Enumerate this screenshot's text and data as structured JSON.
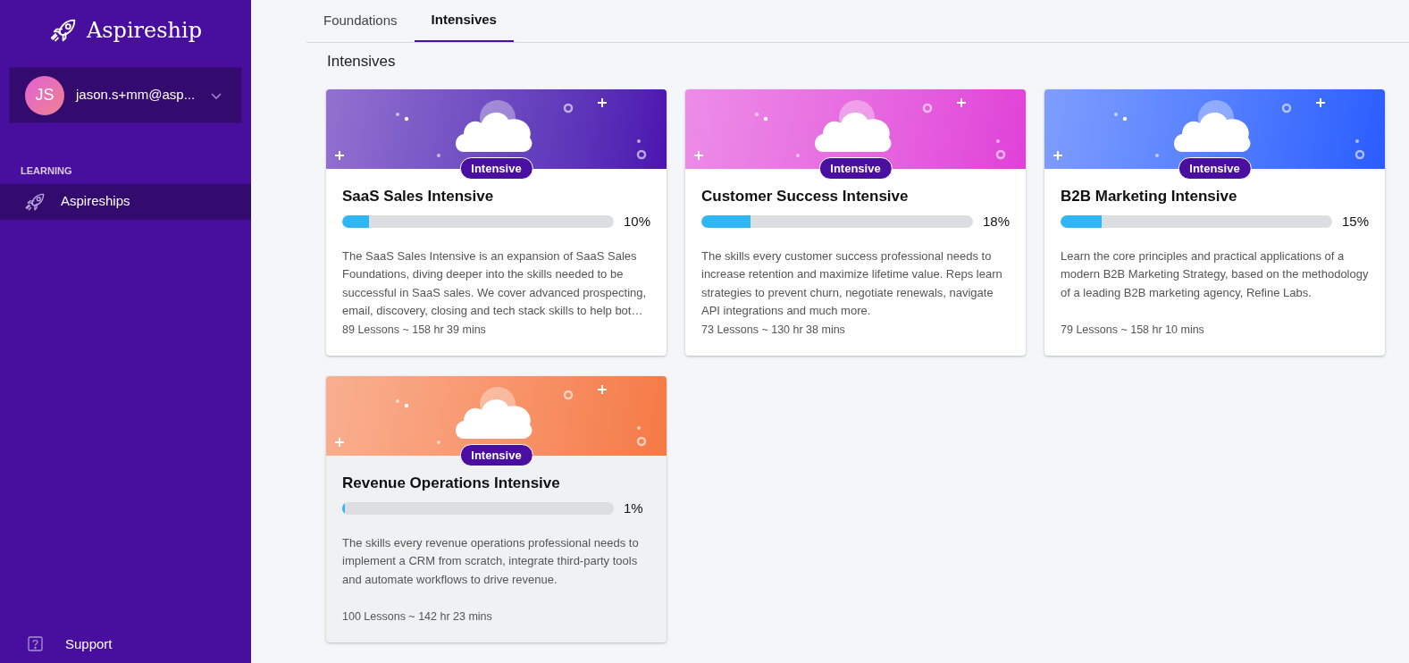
{
  "sidebar": {
    "logo": "Aspireship",
    "user": {
      "initials": "JS",
      "email": "jason.s+mm@asp..."
    },
    "section": "LEARNING",
    "items": [
      {
        "label": "Aspireships",
        "selected": true
      }
    ],
    "footer": {
      "label": "Support"
    }
  },
  "tabs": [
    {
      "label": "Foundations",
      "selected": false
    },
    {
      "label": "Intensives",
      "selected": true
    }
  ],
  "heading": "Intensives",
  "cards": [
    {
      "badge": "Intensive",
      "color": "#4c12b0",
      "title": "SaaS Sales Intensive",
      "level": 0.1,
      "percent": "10%",
      "description": "The SaaS Sales Intensive is an expansion of SaaS Sales Foundations, diving deeper into the skills needed to be successful in SaaS sales. We cover advanced prospecting, email, discovery, closing and tech stack skills to help bot…",
      "meta": "89 Lessons ~ 158 hr 39 mins",
      "highlighted": false
    },
    {
      "badge": "Intensive",
      "color": "#e040d8",
      "title": "Customer Success Intensive",
      "level": 0.18,
      "percent": "18%",
      "description": "The skills every customer success professional needs to increase retention and maximize lifetime value. Reps learn strategies to prevent churn, negotiate renewals, navigate API integrations and much more.",
      "meta": "73 Lessons ~ 130 hr 38 mins",
      "highlighted": false
    },
    {
      "badge": "Intensive",
      "color": "#2a5cff",
      "title": "B2B Marketing Intensive",
      "level": 0.15,
      "percent": "15%",
      "description": "Learn the core principles and practical applications of a modern B2B Marketing Strategy, based on the methodology of a leading B2B marketing agency, Refine Labs.",
      "meta": "79 Lessons ~ 158 hr 10 mins",
      "highlighted": false
    },
    {
      "badge": "Intensive",
      "color": "#f57a45",
      "title": "Revenue Operations Intensive",
      "level": 0.01,
      "percent": "1%",
      "description": "The skills every revenue operations professional needs to implement a CRM from scratch, integrate third-party tools and automate workflows to drive revenue.",
      "meta": "100 Lessons ~ 142 hr 23 mins",
      "highlighted": true
    }
  ]
}
